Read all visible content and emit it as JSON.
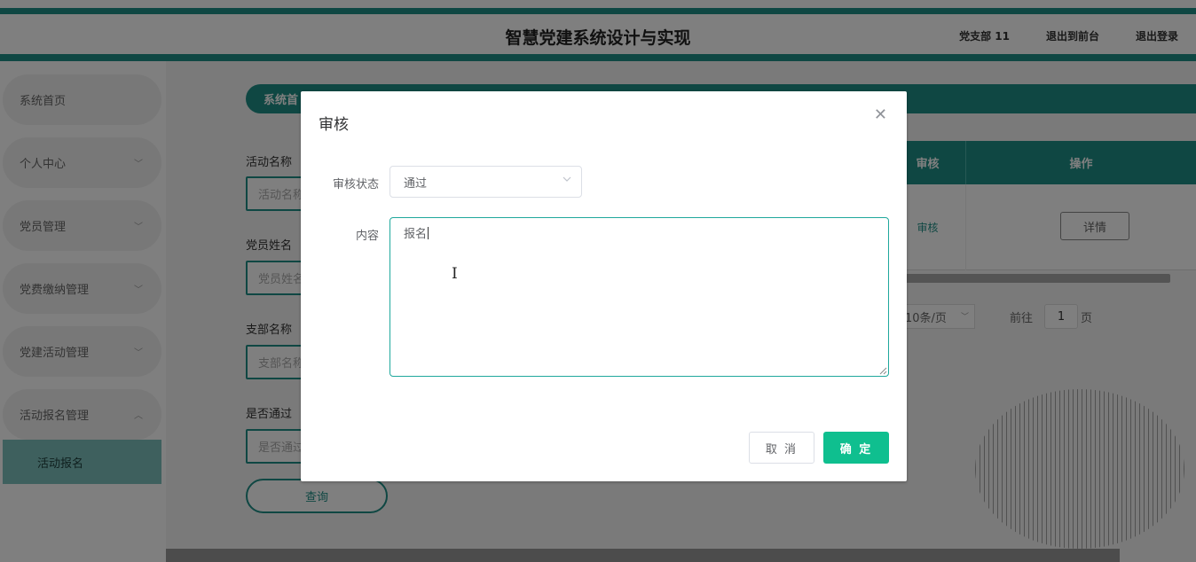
{
  "header": {
    "title": "智慧党建系统设计与实现",
    "user": "党支部 11",
    "to_front": "退出到前台",
    "logout": "退出登录"
  },
  "sidebar": {
    "items": [
      {
        "label": "系统首页"
      },
      {
        "label": "个人中心",
        "icon": "chevron-down-icon"
      },
      {
        "label": "党员管理",
        "icon": "chevron-down-icon"
      },
      {
        "label": "党费缴纳管理",
        "icon": "chevron-down-icon"
      },
      {
        "label": "党建活动管理",
        "icon": "chevron-down-icon"
      },
      {
        "label": "活动报名管理",
        "icon": "chevron-up-icon",
        "expanded": true
      }
    ],
    "submenu": {
      "label": "活动报名",
      "active": true
    }
  },
  "main": {
    "breadcrumb": "系统首",
    "filters": [
      {
        "label": "活动名称",
        "placeholder": "活动名称"
      },
      {
        "label": "党员姓名",
        "placeholder": "党员姓名"
      },
      {
        "label": "支部名称",
        "placeholder": "支部名称"
      },
      {
        "label": "是否通过",
        "placeholder": "是否通过"
      }
    ],
    "query_button": "查询",
    "table": {
      "columns": {
        "audit": "审核",
        "operation": "操作"
      },
      "row": {
        "audit_link": "审核",
        "detail_button": "详情"
      }
    },
    "pagination": {
      "page_size": "10条/页",
      "goto_label": "前往",
      "page_number": "1",
      "page_suffix": "页"
    }
  },
  "dialog": {
    "title": "审核",
    "status_label": "审核状态",
    "status_value": "通过",
    "content_label": "内容",
    "content_value": "报名",
    "cancel": "取 消",
    "confirm": "确 定"
  },
  "colors": {
    "primary": "#1f8f86",
    "confirm": "#0fbf8f",
    "overlay": "rgba(0,0,0,0.5)"
  }
}
